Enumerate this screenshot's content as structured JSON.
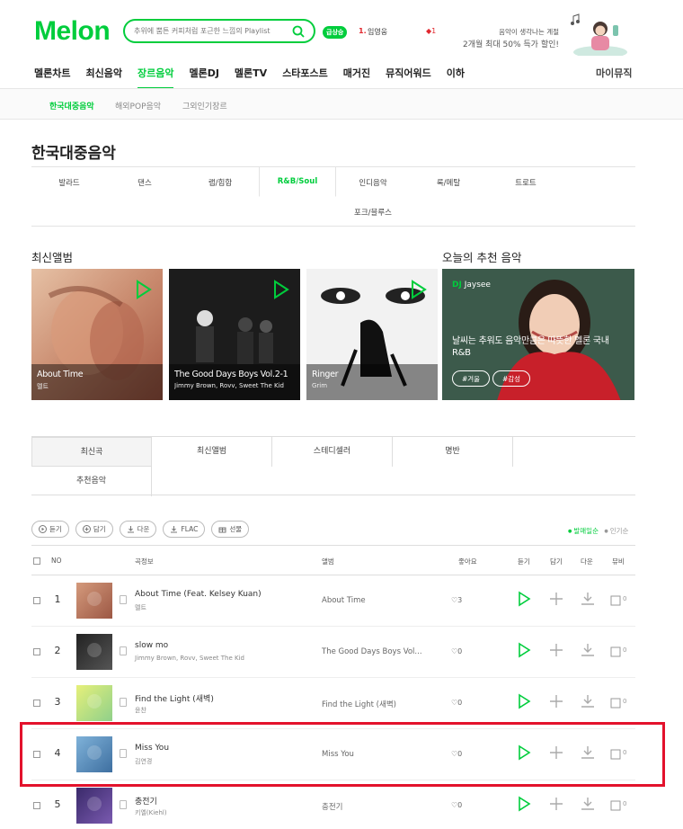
{
  "header": {
    "logo": "Melon",
    "search_placeholder": "추위에 뿜튼 커피처럼 포근한 느낌의 Playlist",
    "live_badge": "급상승",
    "rank_num": "1.",
    "rank_title": "임영웅 ",
    "rank_change": "◆1",
    "promo_line1": "음악이 생각나는 계절",
    "promo_line2": "2개월 최대 50% 득가 할인!"
  },
  "gnb": {
    "items": [
      "멜론차트",
      "최신음악",
      "장르음악",
      "멜론DJ",
      "멜론TV",
      "스타포스트",
      "매거진",
      "뮤직어워드",
      "이하"
    ],
    "active_index": 2,
    "my_music": "마이뮤직"
  },
  "subnav": [
    "한국대중음악",
    "해외POP음악",
    "그외인기장르"
  ],
  "page_title": "한국대중음악",
  "genres": {
    "row1": [
      "발라드",
      "댄스",
      "랩/힙합",
      "R&B/Soul",
      "인디음악",
      "록/메탈",
      "트로트"
    ],
    "row2": [
      "포크/블루스"
    ],
    "active": "R&B/Soul"
  },
  "sections": {
    "new_albums": "최신앨범",
    "recommended": "오늘의 추천 음악"
  },
  "albums": [
    {
      "title": "About Time",
      "artist": "멜트",
      "palette": [
        "#c98a6e",
        "#a75a45",
        "#e6c1a5"
      ]
    },
    {
      "title": "The Good Days Boys Vol.2-1",
      "artist": "Jimmy Brown, Rovv, Sweet The Kid",
      "palette": [
        "#1a1a1a",
        "#3b3b3b",
        "#d7d7d7"
      ]
    },
    {
      "title": "Ringer",
      "artist": "Grim",
      "palette": [
        "#f0f0f0",
        "#888888",
        "#111111"
      ]
    }
  ],
  "recommendation": {
    "dj_label": "DJ",
    "dj_name": "Jaysee",
    "description": "날씨는 추워도 음악만큼은 따뜻한 멜론 국내 R&B",
    "tags": [
      "#겨울",
      "#감성"
    ]
  },
  "tabs": {
    "row1": [
      "최신곡",
      "최신앨범",
      "스테디셀러",
      "명반"
    ],
    "row2": [
      "추천음악"
    ],
    "active": "최신곡"
  },
  "actions": {
    "listen": "듣기",
    "add": "담기",
    "download": "다운",
    "flac": "FLAC",
    "gift": "선물"
  },
  "sort": {
    "on": "발매일순",
    "off": "인기순"
  },
  "table_headers": {
    "no": "NO",
    "song_info": "곡정보",
    "album": "앨범",
    "like": "좋아요",
    "play": "듣기",
    "add": "담기",
    "download": "다운",
    "mv": "뮤비"
  },
  "songs": [
    {
      "no": "1",
      "title": "About Time (Feat. Kelsey Kuan)",
      "artist": "멜트",
      "album": "About Time",
      "likes": "3",
      "mv": "0",
      "thumb": [
        "#d49a7c",
        "#9c5744"
      ]
    },
    {
      "no": "2",
      "title": "slow mo",
      "artist": "Jimmy Brown, Rovv, Sweet The Kid",
      "album": "The Good Days Boys Vol...",
      "likes": "0",
      "mv": "0",
      "thumb": [
        "#222",
        "#555"
      ]
    },
    {
      "no": "3",
      "title": "Find the Light (새벽)",
      "artist": "윤찬",
      "album": "Find the Light (새벽)",
      "likes": "0",
      "mv": "0",
      "thumb": [
        "#e6f07a",
        "#8fd08a"
      ]
    },
    {
      "no": "4",
      "title": "Miss You",
      "artist": "김연경",
      "album": "Miss You",
      "likes": "0",
      "mv": "0",
      "thumb": [
        "#7fb2d9",
        "#3e6fa0"
      ]
    },
    {
      "no": "5",
      "title": "충전기",
      "artist": "키엘(Kiehl)",
      "album": "충전기",
      "likes": "0",
      "mv": "0",
      "thumb": [
        "#3a2a6a",
        "#7a5ab0"
      ]
    }
  ],
  "colors": {
    "brand": "#00cd3c",
    "highlight": "#e3122c"
  }
}
